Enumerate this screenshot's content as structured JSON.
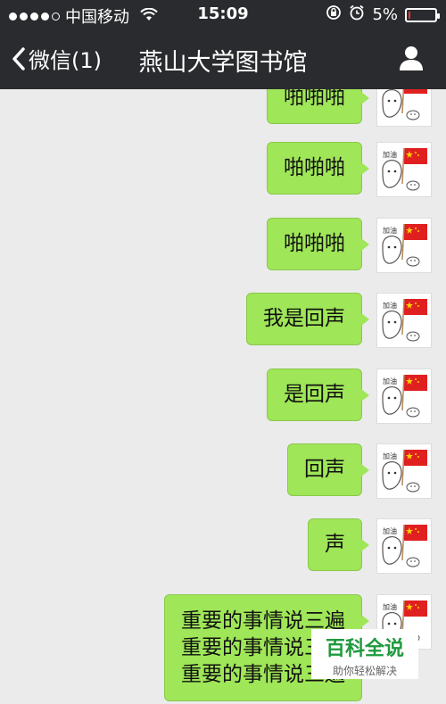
{
  "status": {
    "carrier": "中国移动",
    "time": "15:09",
    "battery": "5%",
    "battery_level": 0.05
  },
  "nav": {
    "back_label": "微信(1)",
    "title": "燕山大学图书馆"
  },
  "messages": [
    {
      "text": "啪啪啪"
    },
    {
      "text": "啪啪啪"
    },
    {
      "text": "啪啪啪"
    },
    {
      "text": "我是回声"
    },
    {
      "text": "是回声"
    },
    {
      "text": "回声"
    },
    {
      "text": "声"
    },
    {
      "lines": [
        "重要的事情说三遍",
        "重要的事情说三遍",
        "重要的事情说三遍"
      ]
    }
  ],
  "avatar_sticker": {
    "text": "加油"
  },
  "watermark": {
    "title": "百科全说",
    "subtitle": "助你轻松解决"
  }
}
